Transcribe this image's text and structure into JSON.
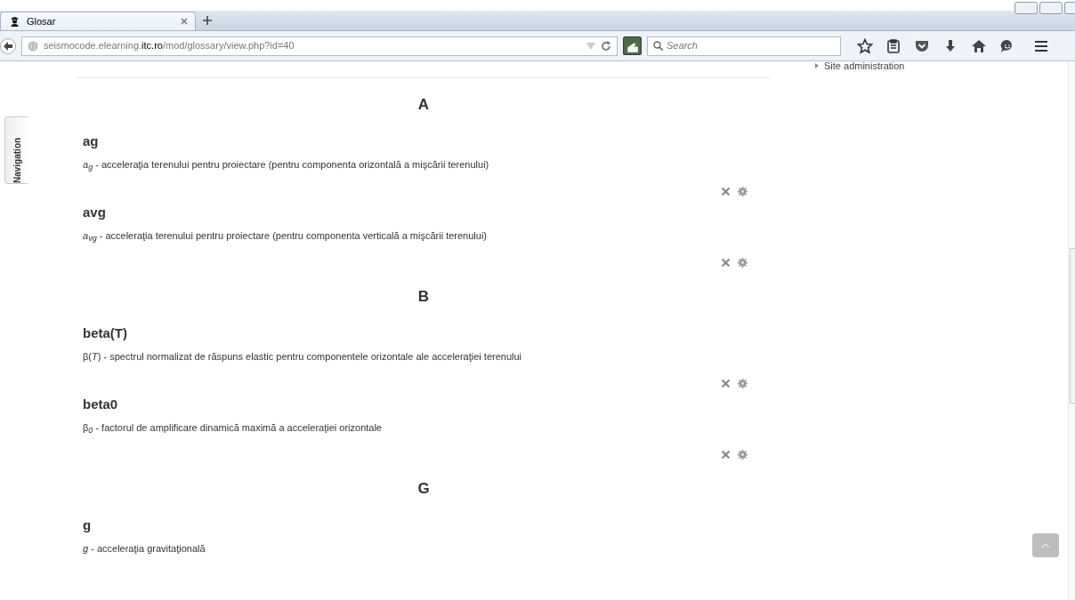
{
  "browser": {
    "tab": {
      "title": "Glosar",
      "selected": true
    },
    "url": "seismocode.elearning.**itc.ro**/mod/glossary/view.php?id=40",
    "search": {
      "placeholder": "Search"
    }
  },
  "navigation_tab": "Navigation",
  "sidebar": {
    "items": [
      "Site administration"
    ]
  },
  "sections": [
    {
      "letter": "A",
      "entries": [
        {
          "term": "ag",
          "definition": "*a*$_{g}$ - acceleraţia terenului pentru proiectare (pentru componenta orizontală a mişcării terenului)",
          "actions": true
        },
        {
          "term": "avg",
          "definition": "*a*$_{vg}$ - acceleraţia terenului pentru proiectare (pentru componenta verticală a mişcării terenului)",
          "actions": true
        }
      ]
    },
    {
      "letter": "B",
      "entries": [
        {
          "term": "beta(T)",
          "definition": "β(*T*) - spectrul normalizat de răspuns elastic pentru componentele orizontale ale acceleraţiei terenului",
          "actions": true
        },
        {
          "term": "beta0",
          "definition": "β$_{0}$ -  factorul de amplificare dinamică maximă a acceleraţiei orizontale",
          "actions": true
        }
      ]
    },
    {
      "letter": "G",
      "entries": [
        {
          "term": "g",
          "definition": "*g* - acceleraţia gravitaţională",
          "actions": false
        }
      ]
    }
  ]
}
